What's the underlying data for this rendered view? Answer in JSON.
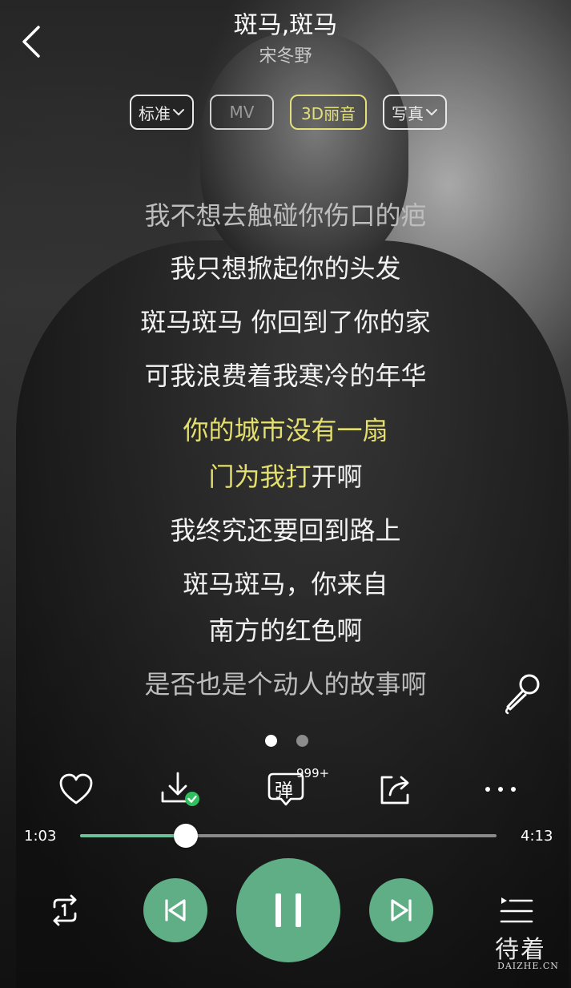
{
  "header": {
    "title": "斑马,斑马",
    "artist": "宋冬野"
  },
  "modes": {
    "standard_label": "标准",
    "mv_label": "MV",
    "sound3d_label": "3D丽音",
    "photo_label": "写真"
  },
  "lyrics": {
    "line1": "我不想去触碰你伤口的疤",
    "line2": "我只想掀起你的头发",
    "line3": "斑马斑马 你回到了你的家",
    "line4": "可我浪费着我寒冷的年华",
    "line5": "你的城市没有一扇",
    "line6_sung": "门为我打",
    "line6_rest": "开啊",
    "line7": "我终究还要回到路上",
    "line8": "斑马斑马，你来自",
    "line9": "南方的红色啊",
    "line10": "是否也是个动人的故事啊"
  },
  "actions": {
    "danmaku_glyph": "弹",
    "danmaku_count": "999+"
  },
  "progress": {
    "current": "1:03",
    "total": "4:13",
    "played_fraction": 0.254
  },
  "pager": {
    "pages": 2,
    "active": 1
  },
  "watermark": {
    "main": "待着",
    "sub": "DAIZHE.CN"
  },
  "colors": {
    "accent": "#5fae86",
    "lyric_highlight": "#e3df6e",
    "progress": "#6cc198"
  }
}
